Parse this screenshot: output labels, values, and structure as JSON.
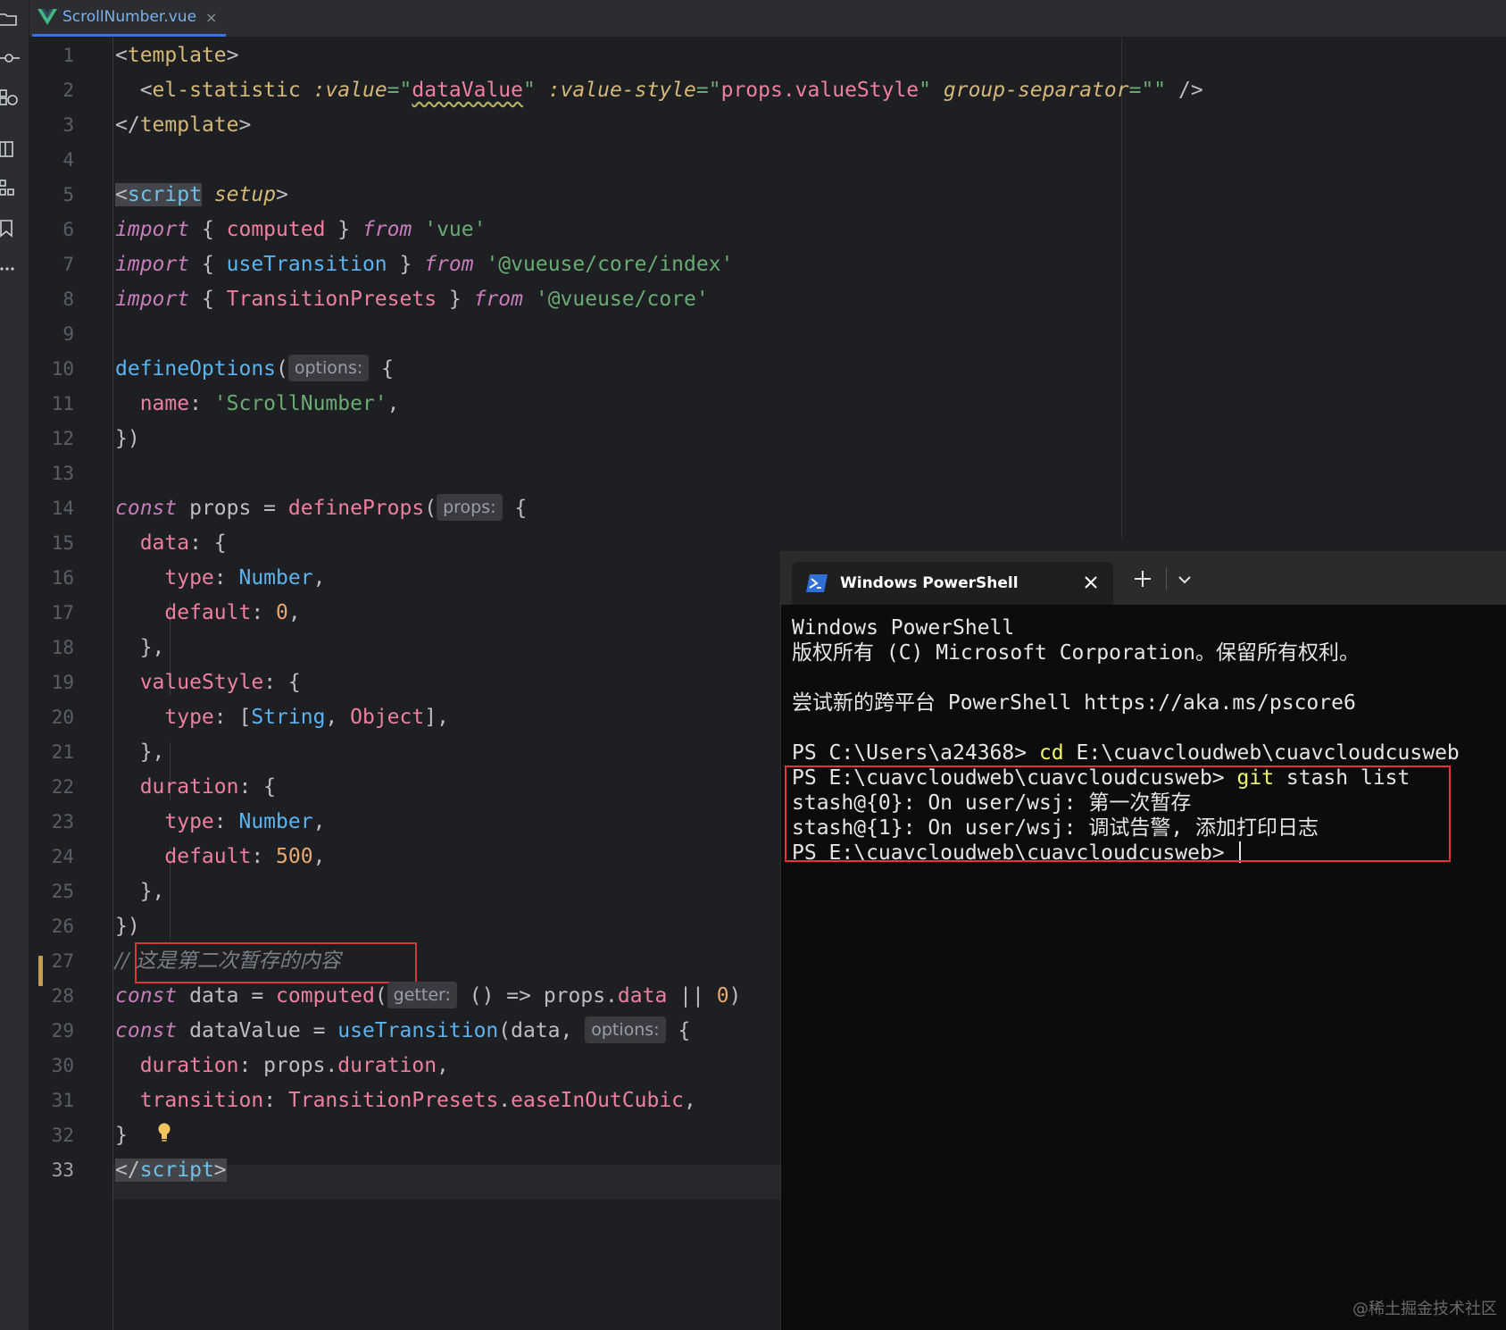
{
  "window": {
    "tab_filename": "ScrollNumber.vue",
    "tab_close": "×"
  },
  "toolstrip": {
    "icons": [
      "folder-icon",
      "commit-icon",
      "plugins-icon",
      "structure-icon",
      "modules-icon",
      "bookmark-icon",
      "more-icon"
    ]
  },
  "editor": {
    "line_numbers": [
      "1",
      "2",
      "3",
      "4",
      "5",
      "6",
      "7",
      "8",
      "9",
      "10",
      "11",
      "12",
      "13",
      "14",
      "15",
      "16",
      "17",
      "18",
      "19",
      "20",
      "21",
      "22",
      "23",
      "24",
      "25",
      "26",
      "27",
      "28",
      "29",
      "30",
      "31",
      "32",
      "33"
    ],
    "current_line": "33",
    "hints": {
      "options1": "options:",
      "props": "props:",
      "getter": "getter:",
      "options2": "options:"
    },
    "code": {
      "l1": [
        "<",
        "template",
        ">"
      ],
      "l2": [
        "  <",
        "el-statistic",
        " ",
        ":value",
        "=\"",
        "dataValue",
        "\"",
        " ",
        ":value-style",
        "=\"",
        "props.valueStyle",
        "\"",
        " ",
        "group-separator",
        "=\"\"",
        " />"
      ],
      "l3": [
        "</",
        "template",
        ">"
      ],
      "l5": [
        "<",
        "script",
        " ",
        "setup",
        ">"
      ],
      "l6": [
        "import",
        " { ",
        "computed",
        " } ",
        "from",
        " ",
        "'vue'"
      ],
      "l7": [
        "import",
        " { ",
        "useTransition",
        " } ",
        "from",
        " ",
        "'@vueuse/core/index'"
      ],
      "l8": [
        "import",
        " { ",
        "TransitionPresets",
        " } ",
        "from",
        " ",
        "'@vueuse/core'"
      ],
      "l10": [
        "defineOptions",
        "(",
        " {"
      ],
      "l11": [
        "  ",
        "name",
        ": ",
        "'ScrollNumber'",
        ","
      ],
      "l12": [
        "})"
      ],
      "l14": [
        "const",
        " props = ",
        "defineProps",
        "(",
        " {"
      ],
      "l15": [
        "  ",
        "data",
        ": {"
      ],
      "l16": [
        "    ",
        "type",
        ": ",
        "Number",
        ","
      ],
      "l17": [
        "    ",
        "default",
        ": ",
        "0",
        ","
      ],
      "l18": [
        "  },"
      ],
      "l19": [
        "  ",
        "valueStyle",
        ": {"
      ],
      "l20": [
        "    ",
        "type",
        ": [",
        "String",
        ", ",
        "Object",
        "],"
      ],
      "l21": [
        "  },"
      ],
      "l22": [
        "  ",
        "duration",
        ": {"
      ],
      "l23": [
        "    ",
        "type",
        ": ",
        "Number",
        ","
      ],
      "l24": [
        "    ",
        "default",
        ": ",
        "500",
        ","
      ],
      "l25": [
        "  },"
      ],
      "l26": [
        "})"
      ],
      "l27": [
        "// 这是第二次暂存的内容"
      ],
      "l28": [
        "const",
        " data = ",
        "computed",
        "(",
        " () => props.",
        "data",
        " || ",
        "0",
        ")"
      ],
      "l29": [
        "const",
        " dataValue = ",
        "useTransition",
        "(data, ",
        " {"
      ],
      "l30": [
        "  ",
        "duration",
        ": props.",
        "duration",
        ","
      ],
      "l31": [
        "  ",
        "transition",
        ": ",
        "TransitionPresets",
        ".",
        "easeInOutCubic",
        ","
      ],
      "l32": [
        "}"
      ],
      "l33": [
        "</",
        "script",
        ">"
      ]
    }
  },
  "terminal": {
    "tab_title": "Windows PowerShell",
    "lines": [
      "Windows PowerShell",
      "版权所有 (C) Microsoft Corporation。保留所有权利。",
      "",
      "尝试新的跨平台 PowerShell https://aka.ms/pscore6",
      "",
      "PS C:\\Users\\a24368> ",
      "PS E:\\cuavcloudweb\\cuavcloudcusweb> ",
      "stash@{0}: On user/wsj: 第一次暂存",
      "stash@{1}: On user/wsj: 调试告警, 添加打印日志",
      "PS E:\\cuavcloudweb\\cuavcloudcusweb> "
    ],
    "commands": {
      "cd": "cd",
      "cd_arg": " E:\\cuavcloudweb\\cuavcloudcusweb",
      "git": "git",
      "git_arg": " stash list"
    }
  },
  "watermark": "@稀土掘金技术社区",
  "colors": {
    "accent": "#3574f0",
    "highlight_box": "#e8323a",
    "terminal_bg": "#0c0c0c",
    "editor_bg": "#1e1f22"
  }
}
